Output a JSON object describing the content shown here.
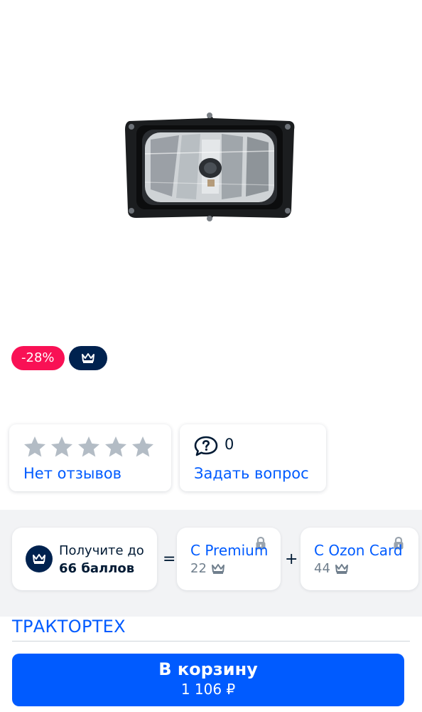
{
  "product": {
    "image_icon": "headlight-image",
    "discount_badge": "-28%",
    "premium_badge_icon": "crown-icon"
  },
  "reviews": {
    "stars_filled": 0,
    "stars_total": 5,
    "link_label": "Нет отзывов"
  },
  "questions": {
    "count": "0",
    "link_label": "Задать вопрос"
  },
  "points": {
    "line1": "Получите до",
    "line2": "66 баллов",
    "equals": "=",
    "plus": "+",
    "premium": {
      "title": "С Premium",
      "points": "22"
    },
    "ozon_card": {
      "title": "С Ozon Card",
      "points": "44"
    }
  },
  "seller": {
    "name": "ТРАКТОРТЕХ"
  },
  "cart": {
    "label": "В корзину",
    "price": "1 106 ₽"
  },
  "colors": {
    "accent": "#005bff",
    "discount": "#f91155",
    "premium": "#00224f",
    "star_empty": "#b3bcc5"
  }
}
